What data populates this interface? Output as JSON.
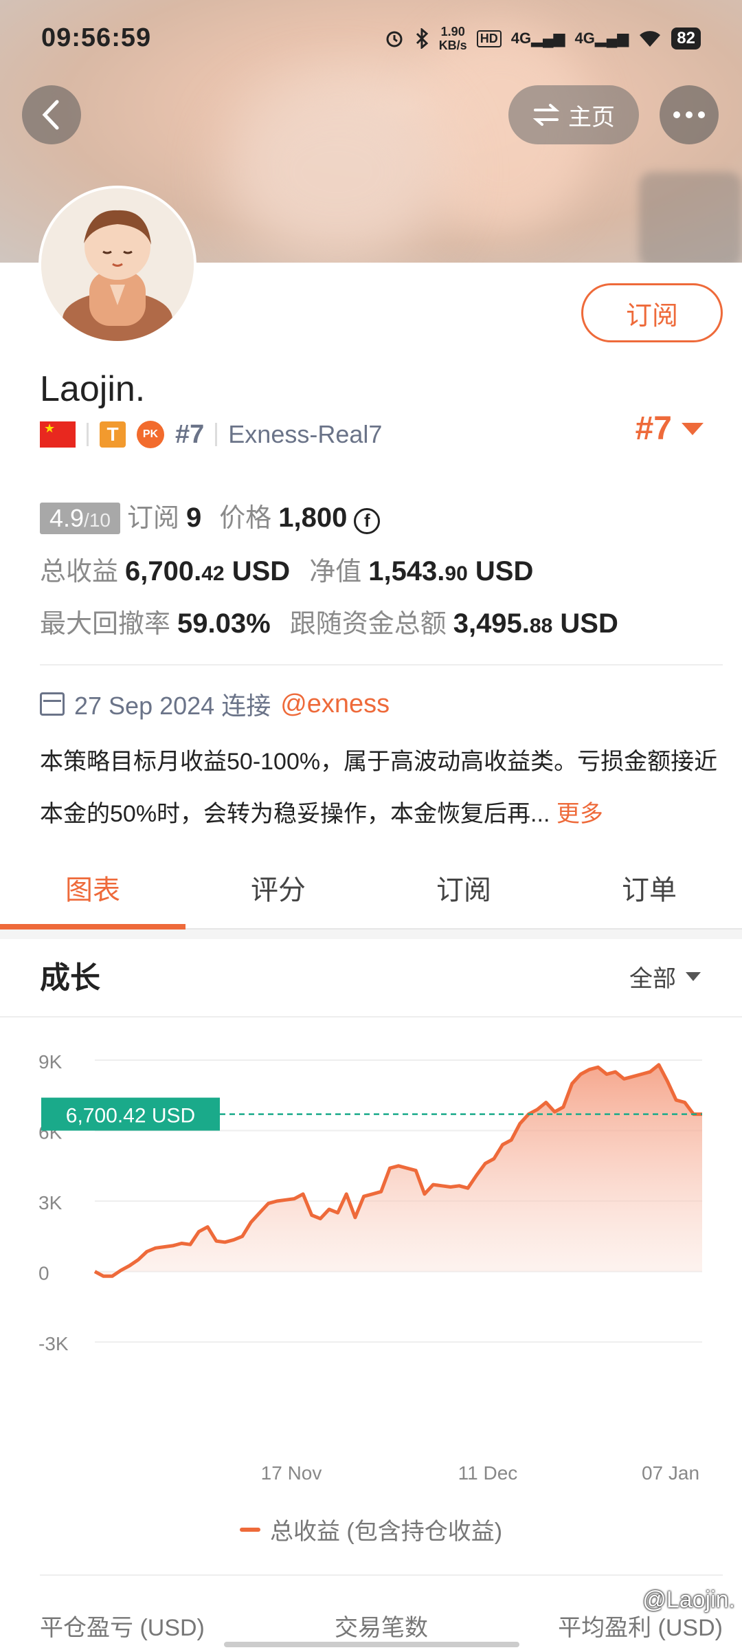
{
  "status": {
    "time": "09:56:59",
    "net_speed_value": "1.90",
    "net_speed_unit": "KB/s",
    "hd": "HD",
    "sim1": "4G",
    "sim2": "4G",
    "battery": "82"
  },
  "header": {
    "home_label": "主页"
  },
  "profile": {
    "name": "Laojin.",
    "subscribe_label": "订阅",
    "t_badge": "T",
    "pk_badge": "PK",
    "rank": "#7",
    "server": "Exness-Real7",
    "rank_right": "#7"
  },
  "stats": {
    "score": "4.9",
    "score_max": "/10",
    "subscriptions_label": "订阅",
    "subscriptions_value": "9",
    "price_label": "价格",
    "price_value": "1,800",
    "coin_symbol": "f",
    "total_profit_label": "总收益",
    "total_profit_int": "6,700.",
    "total_profit_dec": "42",
    "total_profit_unit": "USD",
    "equity_label": "净值",
    "equity_int": "1,543.",
    "equity_dec": "90",
    "equity_unit": "USD",
    "max_drawdown_label": "最大回撤率",
    "max_drawdown_value": "59.03%",
    "follow_funds_label": "跟随资金总额",
    "follow_funds_int": "3,495.",
    "follow_funds_dec": "88",
    "follow_funds_unit": "USD"
  },
  "connect": {
    "date": "27 Sep 2024 连接",
    "broker": "@exness"
  },
  "description": {
    "text": "本策略目标月收益50-100%，属于高波动高收益类。亏损金额接近本金的50%时，会转为稳妥操作，本金恢复后再...",
    "more": "更多"
  },
  "tabs": [
    {
      "label": "图表",
      "active": true
    },
    {
      "label": "评分",
      "active": false
    },
    {
      "label": "订阅",
      "active": false
    },
    {
      "label": "订单",
      "active": false
    }
  ],
  "growth": {
    "title": "成长",
    "range": "全部"
  },
  "chart_data": {
    "type": "area",
    "y_ticks": [
      "9K",
      "6K",
      "3K",
      "0",
      "-3K"
    ],
    "x_ticks": [
      "17 Nov",
      "11 Dec",
      "07 Jan"
    ],
    "ylim": [
      -3000,
      9000
    ],
    "current_label": "6,700.42 USD",
    "current_value": 6700.42,
    "line_color": "#ee6a3a",
    "reference_color": "#1aaa8a",
    "series": [
      {
        "name": "总收益 (包含持仓收益)",
        "values": [
          0,
          -200,
          -200,
          50,
          250,
          500,
          850,
          1000,
          1050,
          1100,
          1200,
          1150,
          1700,
          1900,
          1300,
          1250,
          1350,
          1500,
          2100,
          2500,
          2900,
          3000,
          3050,
          3100,
          3300,
          2400,
          2250,
          2650,
          2500,
          3300,
          2300,
          3200,
          3300,
          3400,
          4400,
          4500,
          4400,
          4300,
          3300,
          3700,
          3650,
          3600,
          3650,
          3550,
          4100,
          4600,
          4800,
          5400,
          5600,
          6300,
          6700,
          6900,
          7200,
          6800,
          7000,
          8000,
          8400,
          8600,
          8700,
          8400,
          8500,
          8200,
          8300,
          8400,
          8500,
          8800,
          8100,
          7300,
          7200,
          6700,
          6700
        ]
      }
    ]
  },
  "legend": {
    "label": "总收益 (包含持仓收益)"
  },
  "footer": {
    "col1": "平仓盈亏 (USD)",
    "col2": "交易笔数",
    "col3": "平均盈利 (USD)",
    "watermark": "@Laojin."
  }
}
